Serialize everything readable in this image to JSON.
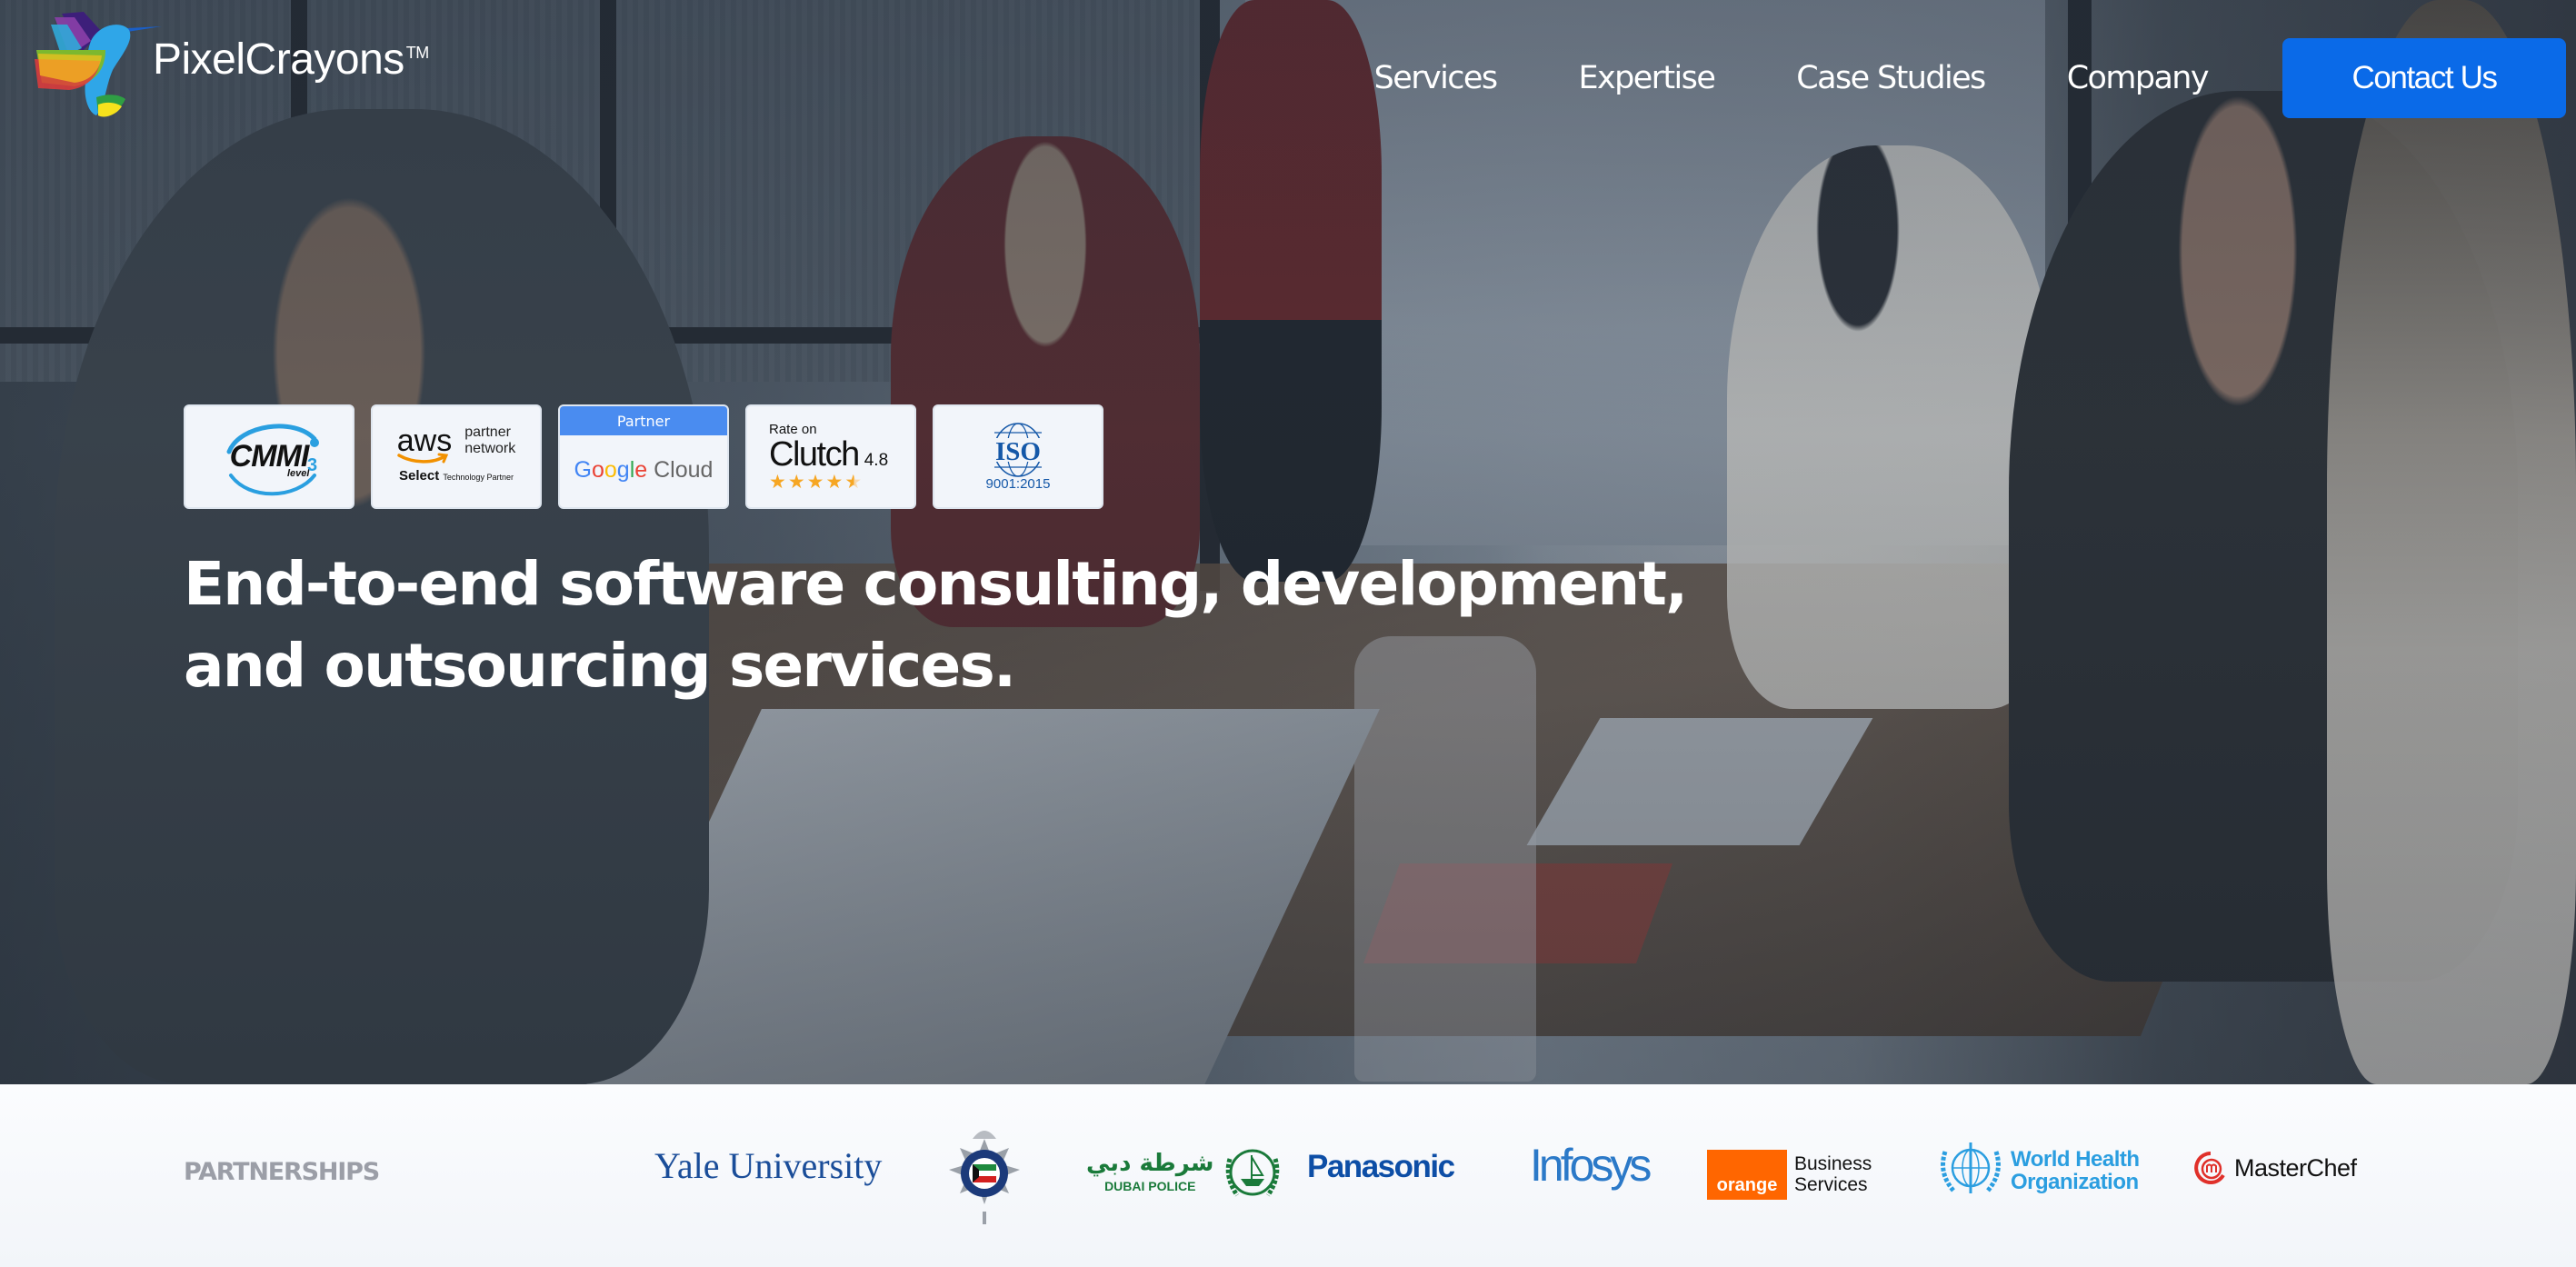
{
  "brand": {
    "name": "PixelCrayons",
    "trademark": "TM"
  },
  "nav": {
    "items": [
      {
        "label": "Services"
      },
      {
        "label": "Expertise"
      },
      {
        "label": "Case Studies"
      },
      {
        "label": "Company"
      }
    ],
    "cta_label": "Contact Us",
    "cta_color": "#0a6ae8"
  },
  "badges": {
    "cmmi": {
      "word": "CMMI",
      "level_label": "level",
      "level": "3"
    },
    "aws": {
      "word": "aws",
      "line1": "partner",
      "line2": "network",
      "tier": "Select",
      "tier_suffix": "Technology Partner"
    },
    "google": {
      "header": "Partner",
      "word_google": [
        "G",
        "o",
        "o",
        "g",
        "l",
        "e"
      ],
      "word_cloud": "Cloud"
    },
    "clutch": {
      "rate_label": "Rate on",
      "word": "Clutch",
      "score": "4.8",
      "stars_out_of_5": 4.5
    },
    "iso": {
      "word": "ISO",
      "standard": "9001:2015"
    }
  },
  "hero": {
    "headline_line1": "End-to-end software consulting, development,",
    "headline_line2": "and outsourcing services."
  },
  "partnerships": {
    "label": "PARTNERSHIPS",
    "logos": {
      "yale": "Yale University",
      "kuwait_police": "Kuwait Police",
      "dubai_police_ar": "شرطة دبي",
      "dubai_police_en": "DUBAI POLICE",
      "panasonic": "Panasonic",
      "infosys": "Infosys",
      "orange_box": "orange",
      "orange_line1": "Business",
      "orange_line2": "Services",
      "who_line1": "World Health",
      "who_line2": "Organization",
      "masterchef": "MasterChef"
    }
  }
}
